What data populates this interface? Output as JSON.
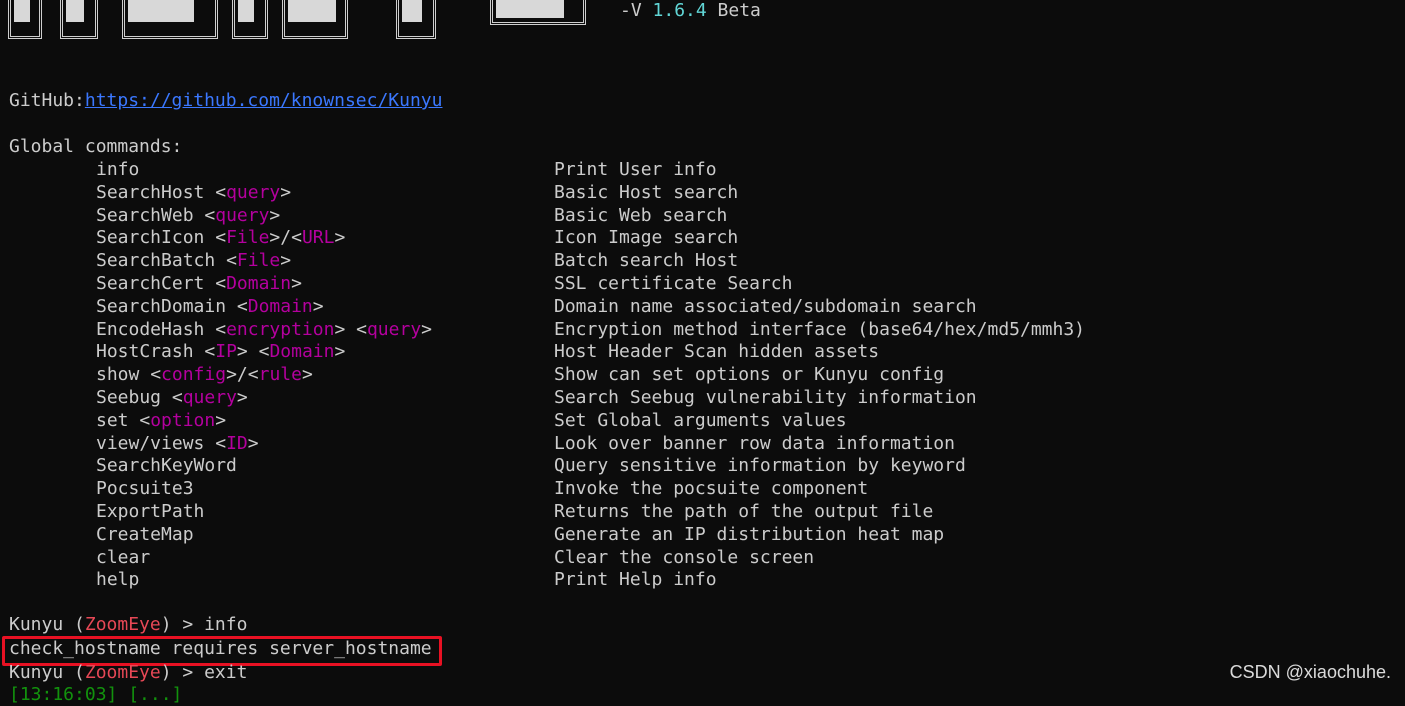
{
  "banner": {
    "version_prefix": "-V ",
    "version_number": "1.6.4",
    "version_suffix": " Beta"
  },
  "github": {
    "label": "GitHub:",
    "url": "https://github.com/knownsec/Kunyu"
  },
  "global_commands_title": "Global commands:",
  "commands": [
    {
      "name": "info",
      "params": [],
      "desc": "Print User info"
    },
    {
      "name": "SearchHost",
      "params": [
        "query"
      ],
      "desc": "Basic Host search"
    },
    {
      "name": "SearchWeb",
      "params": [
        "query"
      ],
      "desc": "Basic Web search"
    },
    {
      "name": "SearchIcon",
      "params": [
        "File",
        "URL"
      ],
      "sep": "/",
      "desc": "Icon Image search"
    },
    {
      "name": "SearchBatch",
      "params": [
        "File"
      ],
      "desc": "Batch search Host"
    },
    {
      "name": "SearchCert",
      "params": [
        "Domain"
      ],
      "desc": "SSL certificate Search"
    },
    {
      "name": "SearchDomain",
      "params": [
        "Domain"
      ],
      "desc": "Domain name associated/subdomain search"
    },
    {
      "name": "EncodeHash",
      "params": [
        "encryption",
        "query"
      ],
      "sep": " ",
      "desc": "Encryption method interface (base64/hex/md5/mmh3)"
    },
    {
      "name": "HostCrash",
      "params": [
        "IP",
        "Domain"
      ],
      "sep": " ",
      "desc": "Host Header Scan hidden assets"
    },
    {
      "name": "show",
      "params": [
        "config",
        "rule"
      ],
      "sep": "/",
      "desc": "Show can set options or Kunyu config"
    },
    {
      "name": "Seebug",
      "params": [
        "query"
      ],
      "desc": "Search Seebug vulnerability information"
    },
    {
      "name": "set",
      "params": [
        "option"
      ],
      "desc": "Set Global arguments values"
    },
    {
      "name": "view/views",
      "params": [
        "ID"
      ],
      "desc": "Look over banner row data information"
    },
    {
      "name": "SearchKeyWord",
      "params": [],
      "desc": "Query sensitive information by keyword"
    },
    {
      "name": "Pocsuite3",
      "params": [],
      "desc": "Invoke the pocsuite component"
    },
    {
      "name": "ExportPath",
      "params": [],
      "desc": "Returns the path of the output file"
    },
    {
      "name": "CreateMap",
      "params": [],
      "desc": "Generate an IP distribution heat map"
    },
    {
      "name": "clear",
      "params": [],
      "desc": "Clear the console screen"
    },
    {
      "name": "help",
      "params": [],
      "desc": "Print Help info"
    }
  ],
  "session": {
    "prompt_prefix": "Kunyu (",
    "prompt_mode": "ZoomEye",
    "prompt_suffix": ") > ",
    "cmd1": "info",
    "error_line": "check_hostname requires server_hostname",
    "cmd2": "exit",
    "partial_last_line": "[13:16:03] [...]"
  },
  "colors": {
    "background": "#0c0c0c",
    "text": "#cccccc",
    "param": "#b4009e",
    "link": "#3b78ff",
    "version": "#61d6d6",
    "prompt_mode": "#e74856",
    "highlight_box": "#e81123"
  },
  "watermark": "CSDN @xiaochuhe."
}
